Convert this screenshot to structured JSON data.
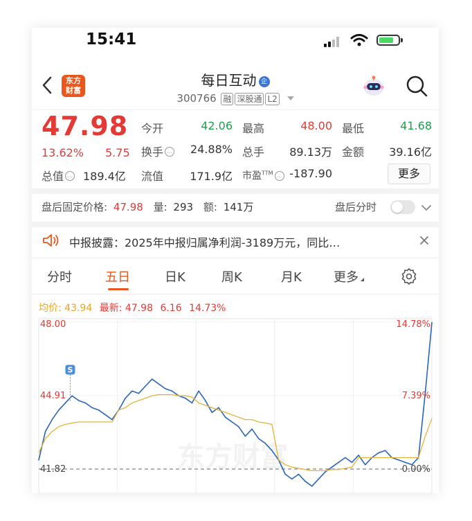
{
  "status_bar": {
    "time": "15:41"
  },
  "header": {
    "logo_line1": "东方",
    "logo_line2": "财富",
    "stock_name": "每日互动",
    "badge": "企",
    "stock_code": "300766",
    "tags": [
      "融",
      "深股通",
      "L2"
    ]
  },
  "quote": {
    "price": "47.98",
    "change_pct": "13.62%",
    "change_amt": "5.75",
    "total_value_label": "总值",
    "total_value": "189.4亿",
    "rows": [
      [
        {
          "label": "今开",
          "value": "42.06",
          "color": "green"
        },
        {
          "label": "最高",
          "value": "48.00",
          "color": "red"
        },
        {
          "label": "最低",
          "value": "41.68",
          "color": "green"
        }
      ],
      [
        {
          "label": "换手",
          "value": "24.88%",
          "color": "gray"
        },
        {
          "label": "总手",
          "value": "89.13万",
          "color": "gray"
        },
        {
          "label": "金额",
          "value": "39.16亿",
          "color": "gray"
        }
      ],
      [
        {
          "label": "流值",
          "value": "171.9亿",
          "color": "gray"
        },
        {
          "label": "市盈",
          "value": "-187.90",
          "color": "gray",
          "sup": "TTM"
        }
      ]
    ],
    "more_label": "更多"
  },
  "after_hours": {
    "price_label": "盘后固定价格:",
    "price": "47.98",
    "volume_label": "量:",
    "volume": "293",
    "amount_label": "额:",
    "amount": "141万",
    "toggle_label": "盘后分时",
    "toggle_on": false
  },
  "notice": {
    "text": "中报披露：2025年中报归属净利润-3189万元，同比…"
  },
  "tabs": [
    {
      "label": "分时",
      "active": false
    },
    {
      "label": "五日",
      "active": true
    },
    {
      "label": "日K",
      "active": false
    },
    {
      "label": "周K",
      "active": false
    },
    {
      "label": "月K",
      "active": false
    },
    {
      "label": "更多",
      "active": false
    }
  ],
  "legend": {
    "avg_label": "均价:",
    "avg_value": "43.94",
    "latest_label": "最新:",
    "latest_value": "47.98",
    "latest_change": "6.16",
    "latest_pct": "14.73%"
  },
  "chart_data": {
    "type": "line",
    "y_labels_left": [
      "48.00",
      "44.91",
      "41.82"
    ],
    "y_labels_right": [
      "14.78%",
      "7.39%",
      "0.00%"
    ],
    "ylim": [
      40.8,
      48.2
    ],
    "base_price": 41.82,
    "days": 5,
    "markers": [
      {
        "label": "S",
        "x": 0.08,
        "y": 45.5
      }
    ],
    "series": [
      {
        "color": "#2a64b8",
        "values": [
          42.2,
          43.4,
          43.9,
          44.3,
          44.6,
          44.9,
          44.7,
          44.6,
          44.4,
          44.3,
          44.1,
          43.9,
          44.3,
          44.8,
          45.1,
          45.0,
          45.3,
          45.6,
          45.4,
          45.2,
          45.1,
          44.9,
          44.8,
          44.6,
          45.1,
          44.7,
          44.2,
          44.4,
          44.0,
          43.8,
          43.6,
          43.2,
          43.5,
          43.1,
          42.9,
          42.6,
          42.2,
          41.6,
          41.4,
          41.6,
          41.3,
          41.1,
          41.4,
          41.7,
          41.9,
          42.1,
          42.3,
          42.1,
          42.4,
          42.0,
          42.3,
          42.5,
          42.6,
          42.3,
          42.2,
          42.1,
          42.0,
          42.3,
          45.0,
          47.98
        ]
      },
      {
        "color": "#e5b23a",
        "values": [
          42.5,
          43.1,
          43.4,
          43.6,
          43.7,
          43.75,
          43.8,
          43.8,
          43.8,
          43.8,
          43.8,
          43.8,
          44.3,
          44.4,
          44.6,
          44.7,
          44.8,
          44.9,
          44.95,
          44.95,
          44.95,
          44.9,
          44.9,
          44.85,
          44.6,
          44.5,
          44.4,
          44.3,
          44.2,
          44.1,
          44.0,
          43.9,
          43.9,
          43.8,
          43.75,
          43.7,
          42.2,
          42.0,
          41.9,
          41.85,
          41.8,
          41.75,
          41.75,
          41.75,
          41.8,
          41.8,
          41.85,
          41.9,
          42.3,
          42.3,
          42.3,
          42.3,
          42.3,
          42.3,
          42.3,
          42.3,
          42.3,
          42.3,
          43.2,
          43.94
        ]
      }
    ]
  },
  "watermark": "东方财富"
}
